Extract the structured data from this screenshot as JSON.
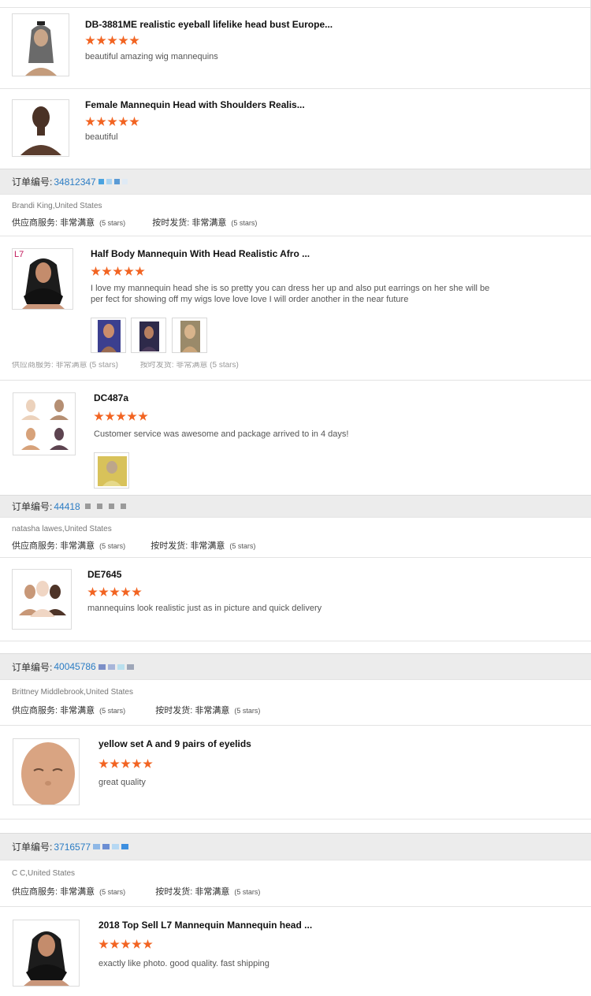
{
  "order_label": "订单编号:",
  "supplier_service_label": "供应商服务:",
  "on_time_label": "按时发货:",
  "items_top": [
    {
      "title": "DB-3881ME realistic eyeball lifelike head bust Europe...",
      "comment": "beautiful amazing wig mannequins"
    },
    {
      "title": "Female Mannequin Head with Shoulders Realis...",
      "comment": "beautiful"
    }
  ],
  "orders": [
    {
      "number": "34812347",
      "buyer": "Brandi King,United States",
      "service_value": "非常满意",
      "service_stars": "(5 stars)",
      "shipping_value": "非常满意",
      "shipping_stars": "(5 stars)",
      "items": [
        {
          "title": "Half Body Mannequin With Head Realistic Afro ...",
          "comment": "I love my mannequin head she is so pretty you can dress her up and also put earrings on her she will be per fect for showing off my wigs love love love I will order another in the near future",
          "logo": "L7"
        },
        {
          "title": "DC487a",
          "comment": "Customer service was awesome and package arrived to in 4 days!"
        }
      ]
    },
    {
      "number": "44418",
      "buyer": "natasha lawes,United States",
      "service_value": "非常满意",
      "service_stars": "(5 stars)",
      "shipping_value": "非常满意",
      "shipping_stars": "(5 stars)",
      "items": [
        {
          "title": "DE7645",
          "comment": "mannequins look realistic just as in picture and quick delivery"
        }
      ]
    },
    {
      "number": "40045786",
      "buyer": "Brittney Middlebrook,United States",
      "service_value": "非常满意",
      "service_stars": "(5 stars)",
      "shipping_value": "非常满意",
      "shipping_stars": "(5 stars)",
      "items": [
        {
          "title": "yellow set A and 9 pairs of eyelids",
          "comment": "great quality"
        }
      ]
    },
    {
      "number": "3716577",
      "buyer": "C C,United States",
      "service_value": "非常满意",
      "service_stars": "(5 stars)",
      "shipping_value": "非常满意",
      "shipping_stars": "(5 stars)",
      "items": [
        {
          "title": "2018 Top Sell L7 Mannequin Mannequin head ...",
          "comment": "exactly like photo. good quality. fast shipping"
        }
      ]
    }
  ],
  "colors": {
    "star": "#f26422",
    "order_number": "#2b7cc4",
    "order_bar_bg": "#ececec"
  }
}
